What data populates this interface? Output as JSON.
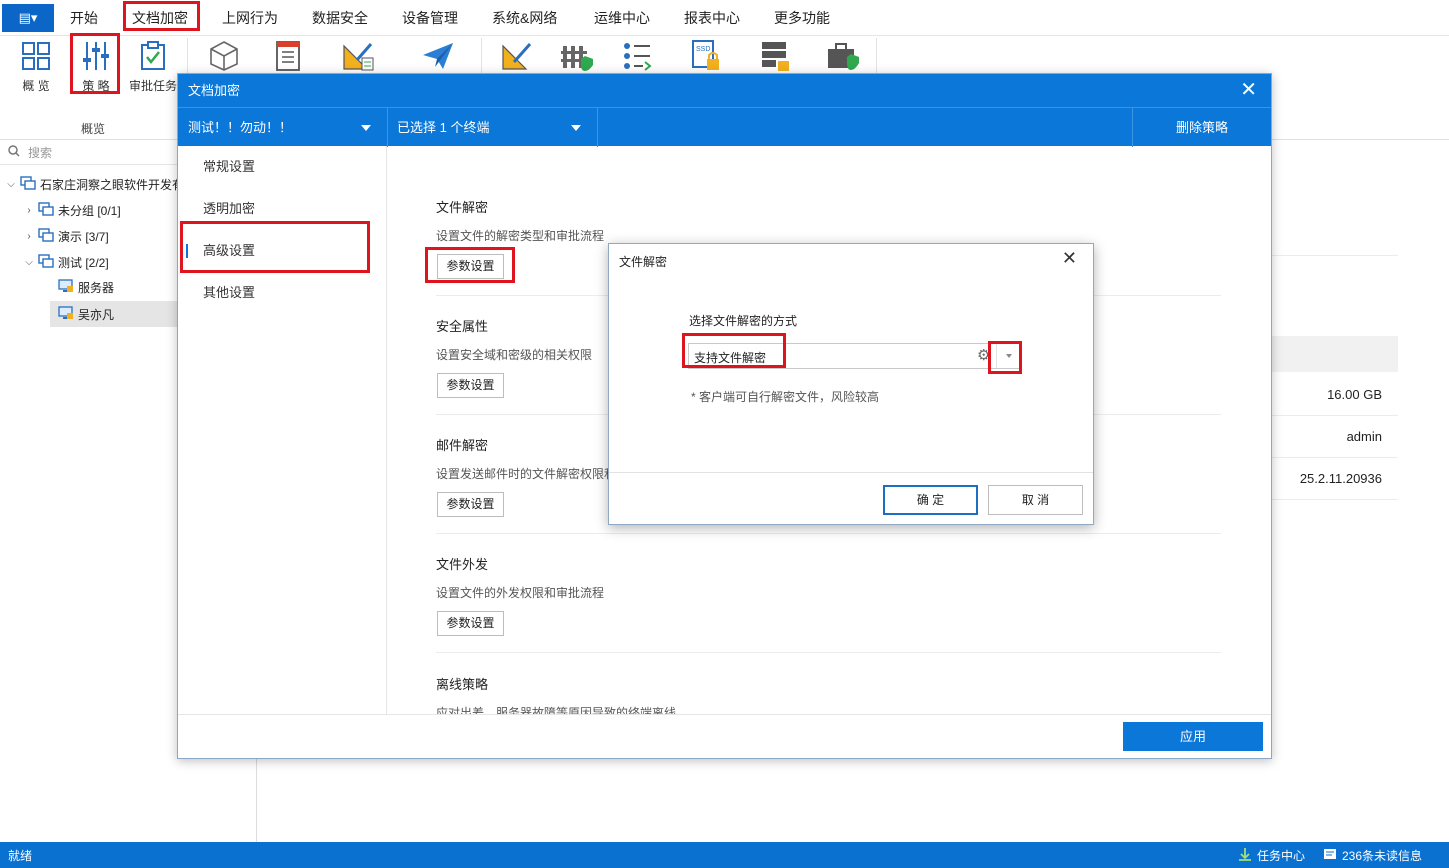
{
  "menubar": {
    "app_button_label": "▤▾",
    "items": [
      "开始",
      "文档加密",
      "上网行为",
      "数据安全",
      "设备管理",
      "系统&网络",
      "运维中心",
      "报表中心",
      "更多功能"
    ]
  },
  "ribbon": {
    "overview_label": "概 览",
    "policy_label": "策 略",
    "approval_label": "审批任务",
    "group_label": "概览"
  },
  "leftpane": {
    "search_placeholder": "搜索",
    "tree": {
      "root": "石家庄洞察之眼软件开发有",
      "ungrouped": "未分组  [0/1]",
      "demo": "演示  [3/7]",
      "test": "测试  [2/2]",
      "server": "服务器",
      "user": "吴亦凡"
    }
  },
  "background": {
    "disk": "16.00 GB",
    "user": "admin",
    "version": "25.2.11.20936"
  },
  "dialog": {
    "title": "文档加密",
    "policy_select": "测试！！勿动！！",
    "terminal_select": "已选择 1 个终端",
    "delete_label": "删除策略",
    "nav": [
      "常规设置",
      "透明加密",
      "高级设置",
      "其他设置"
    ],
    "sections": [
      {
        "title": "文件解密",
        "desc": "设置文件的解密类型和审批流程",
        "button": "参数设置"
      },
      {
        "title": "安全属性",
        "desc": "设置安全域和密级的相关权限",
        "button": "参数设置"
      },
      {
        "title": "邮件解密",
        "desc": "设置发送邮件时的文件解密权限和",
        "button": "参数设置"
      },
      {
        "title": "文件外发",
        "desc": "设置文件的外发权限和审批流程",
        "button": "参数设置"
      },
      {
        "title": "离线策略",
        "desc": "应对出差、服务器故障等原因导致的终端离线"
      }
    ],
    "apply_label": "应用"
  },
  "subdialog": {
    "title": "文件解密",
    "label": "选择文件解密的方式",
    "selected": "支持文件解密",
    "note": "* 客户端可自行解密文件，风险较高",
    "ok_label": "确 定",
    "cancel_label": "取 消"
  },
  "statusbar": {
    "status": "就绪",
    "task_center": "任务中心",
    "unread": "236条未读信息"
  },
  "colors": {
    "accent": "#0b77d8",
    "annotation_red": "#e0141e"
  }
}
